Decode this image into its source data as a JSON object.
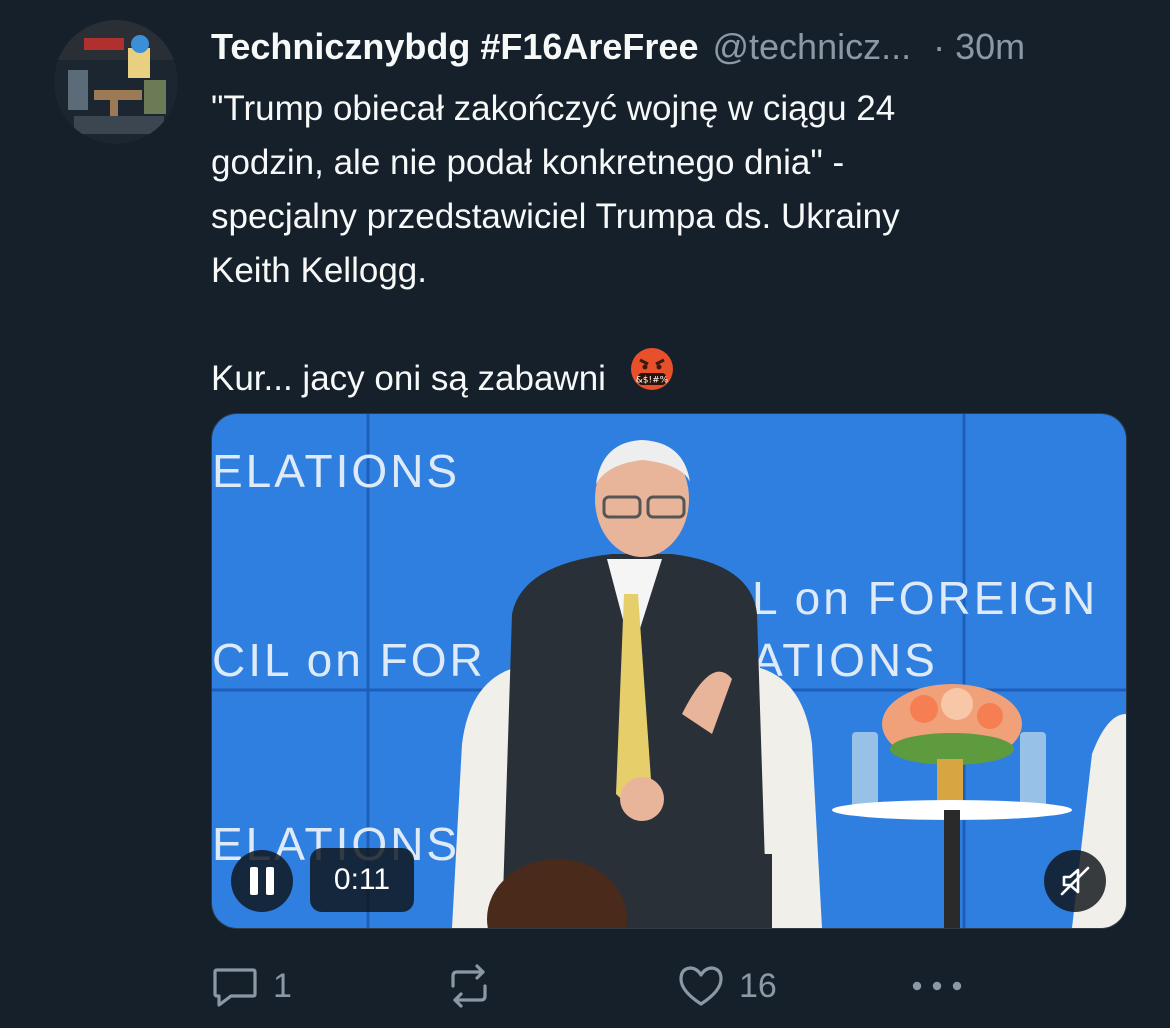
{
  "tweet": {
    "display_name": "Technicznybdg #F16AreFree",
    "handle": "@technicz...",
    "separator": "·",
    "time": "30m",
    "text": "\"Trump obiecał zakończyć wojnę w ciągu 24\ngodzin, ale nie podał konkretnego dnia\" -\nspecjalny przedstawiciel Trumpa ds. Ukrainy\nKeith Kellogg.\n\nKur... jacy oni są zabawni",
    "emoji": "cursing-face-emoji"
  },
  "video": {
    "time": "0:11",
    "background_text": {
      "line1": "ELATIONS",
      "line2": "CIL on FOR",
      "line2b": "ATIONS",
      "line3": "L on FOREIGN",
      "line4": "ELATIONS"
    },
    "icons": {
      "pause": "pause-icon",
      "mute": "volume-muted-icon"
    }
  },
  "actions": {
    "reply": {
      "icon": "reply-icon",
      "count": "1"
    },
    "retweet": {
      "icon": "retweet-icon",
      "count": ""
    },
    "like": {
      "icon": "heart-icon",
      "count": "16"
    },
    "more": {
      "icon": "more-horizontal-icon"
    }
  },
  "colors": {
    "background": "#15202b",
    "text": "#f7f9f9",
    "secondary": "#8b98a5",
    "video_blue": "#2f7fe0"
  }
}
